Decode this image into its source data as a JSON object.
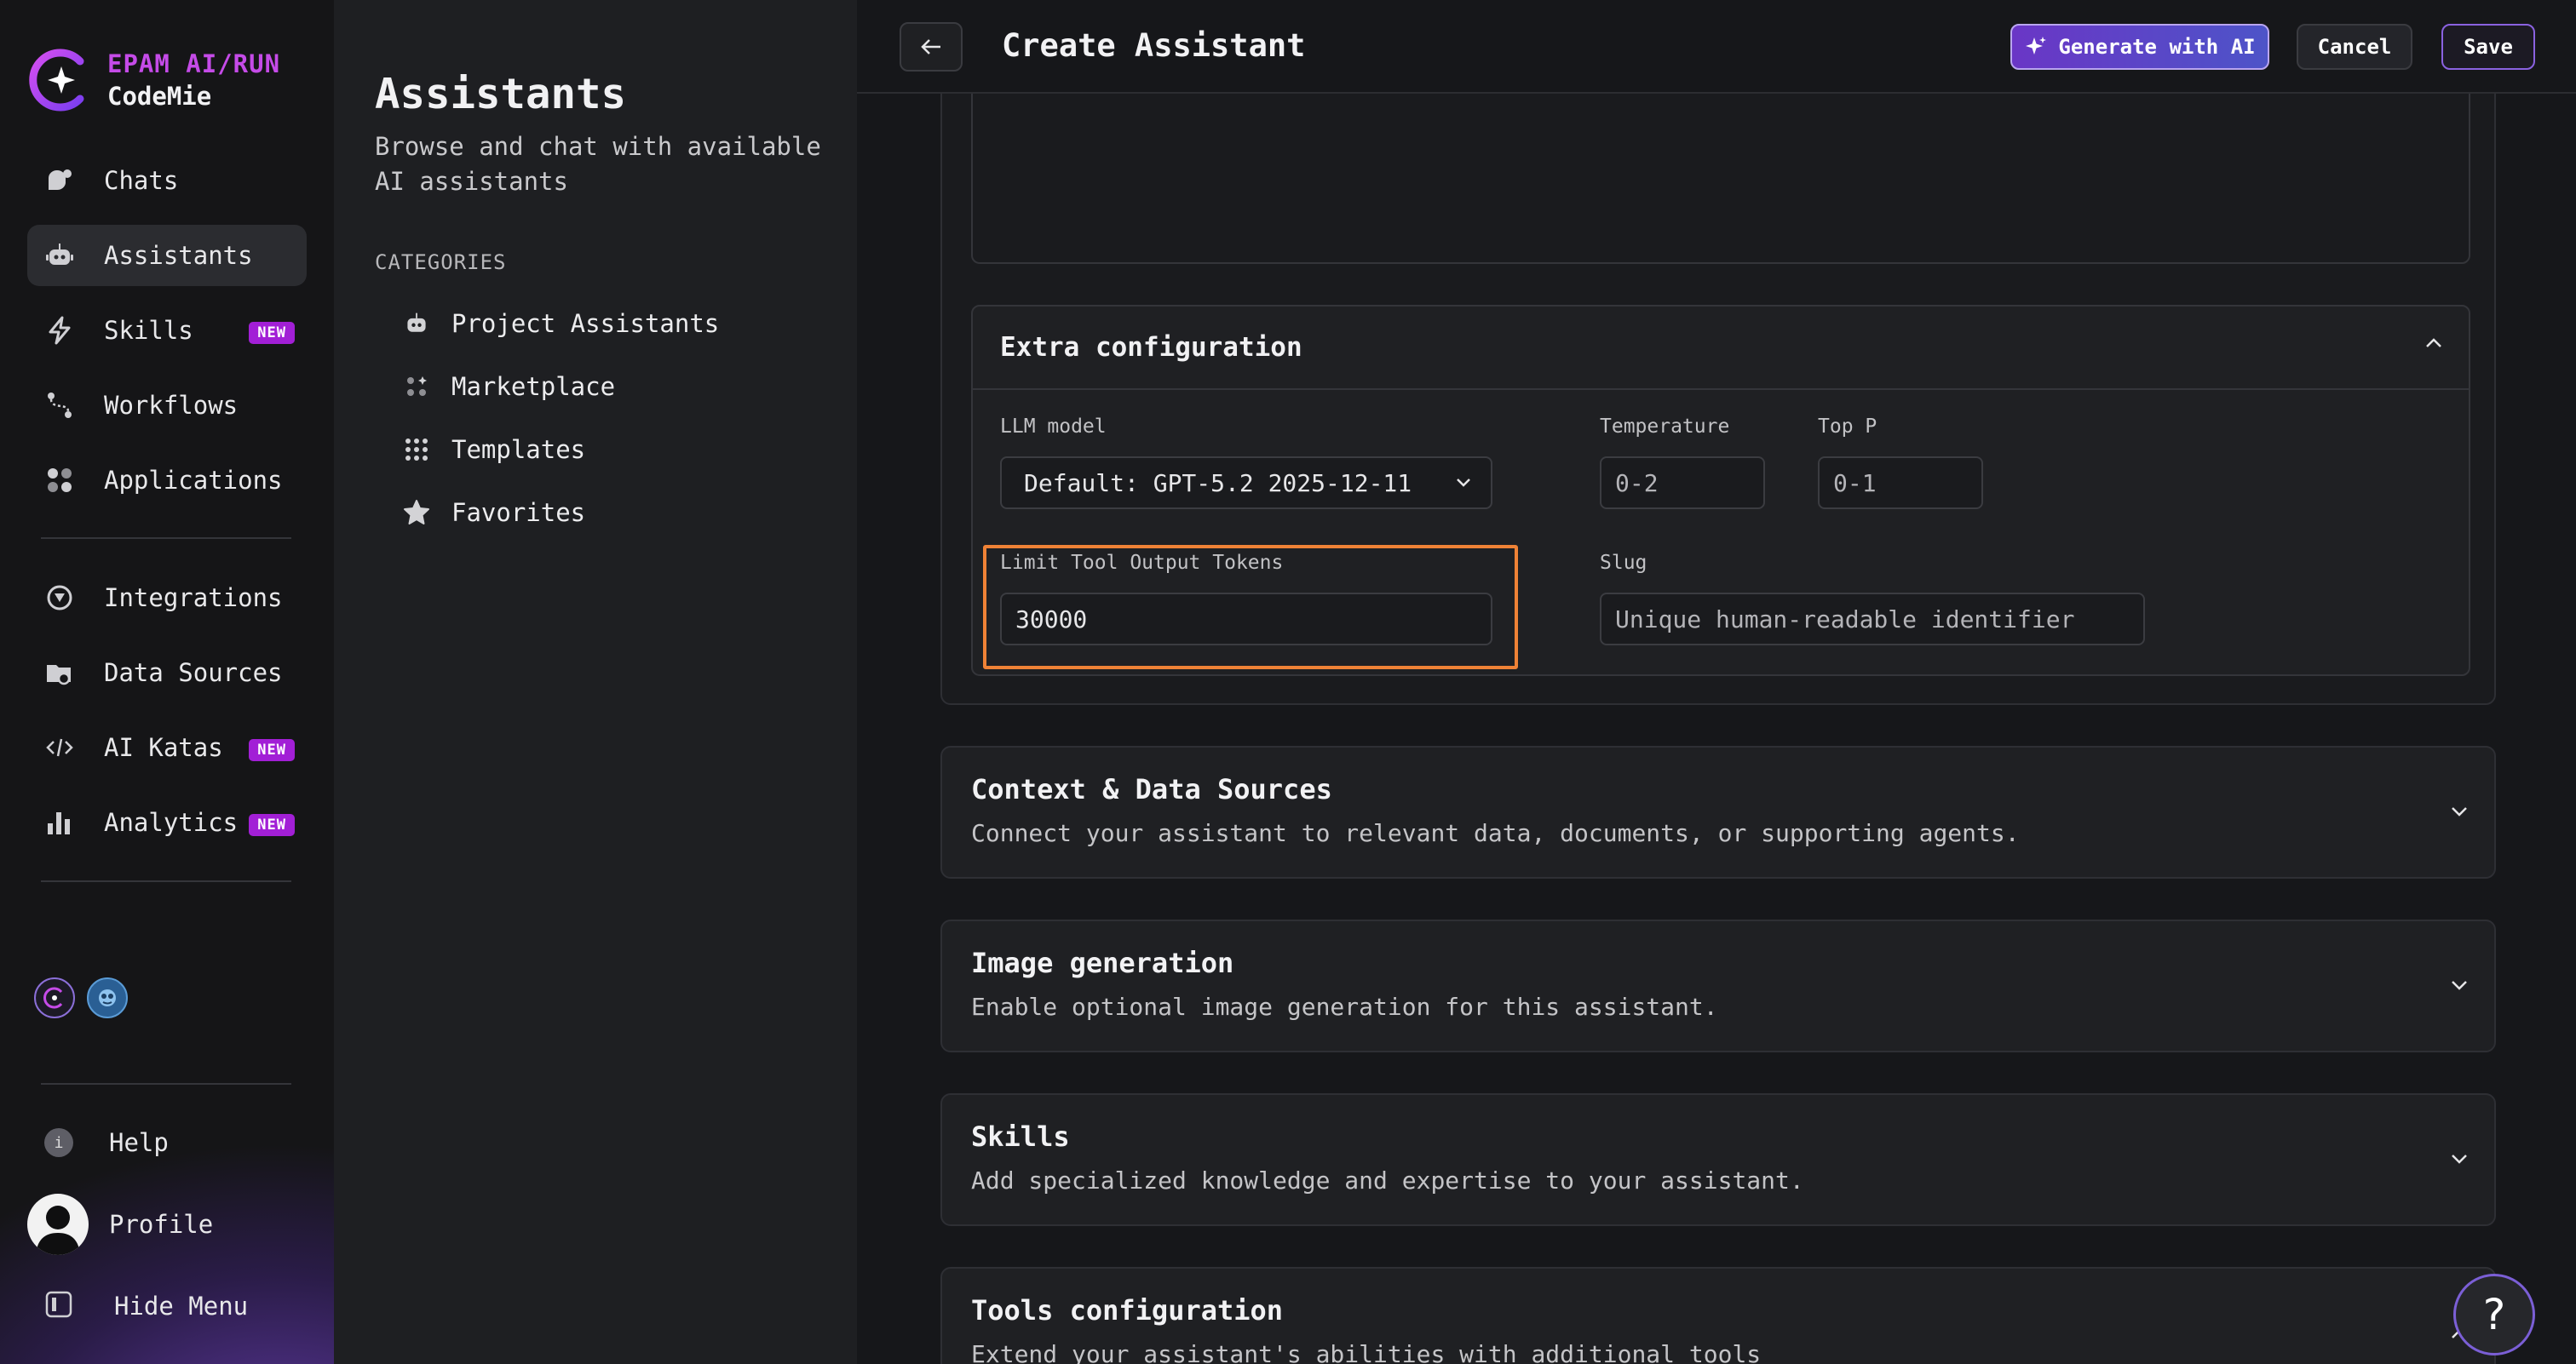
{
  "brand": {
    "line1": "EPAM AI/RUN",
    "line2": "CodeMie",
    "accent": "#c54be8"
  },
  "nav": {
    "items": [
      {
        "label": "Chats",
        "icon": "chats-icon"
      },
      {
        "label": "Assistants",
        "icon": "robot-icon",
        "active": true
      },
      {
        "label": "Skills",
        "icon": "lightning-icon",
        "badge": "NEW"
      },
      {
        "label": "Workflows",
        "icon": "workflow-icon"
      },
      {
        "label": "Applications",
        "icon": "apps-icon"
      },
      {
        "label": "Integrations",
        "icon": "integrations-icon"
      },
      {
        "label": "Data Sources",
        "icon": "data-sources-icon"
      },
      {
        "label": "AI Katas",
        "icon": "code-icon",
        "badge": "NEW"
      },
      {
        "label": "Analytics",
        "icon": "bar-chart-icon",
        "badge": "NEW"
      }
    ],
    "bottom": {
      "help": "Help",
      "profile": "Profile",
      "hide_menu": "Hide Menu"
    }
  },
  "panel": {
    "title": "Assistants",
    "subtitle": "Browse and chat with available AI assistants",
    "categories_title": "CATEGORIES",
    "categories": [
      {
        "label": "Project Assistants",
        "icon": "robot-icon"
      },
      {
        "label": "Marketplace",
        "icon": "marketplace-icon"
      },
      {
        "label": "Templates",
        "icon": "grid-icon"
      },
      {
        "label": "Favorites",
        "icon": "star-icon"
      }
    ]
  },
  "header": {
    "title": "Create Assistant",
    "generate_label": "Generate with AI",
    "cancel_label": "Cancel",
    "save_label": "Save"
  },
  "extra_config": {
    "title": "Extra configuration",
    "llm_label": "LLM model",
    "llm_value": "Default: GPT-5.2 2025-12-11",
    "temperature_label": "Temperature",
    "temperature_placeholder": "0-2",
    "top_p_label": "Top P",
    "top_p_placeholder": "0-1",
    "limit_label": "Limit Tool Output Tokens",
    "limit_value": "30000",
    "slug_label": "Slug",
    "slug_placeholder": "Unique human-readable identifier"
  },
  "sections": [
    {
      "title": "Context & Data Sources",
      "desc": "Connect your assistant to relevant data, documents, or supporting agents."
    },
    {
      "title": "Image generation",
      "desc": "Enable optional image generation for this assistant."
    },
    {
      "title": "Skills",
      "desc": "Add specialized knowledge and expertise to your assistant."
    },
    {
      "title": "Tools configuration",
      "desc": "Extend your assistant's abilities with additional tools"
    }
  ],
  "help_fab": "?",
  "colors": {
    "highlight": "#ef8236",
    "badge": "#a21fd6",
    "save_border": "#8a62e0"
  }
}
